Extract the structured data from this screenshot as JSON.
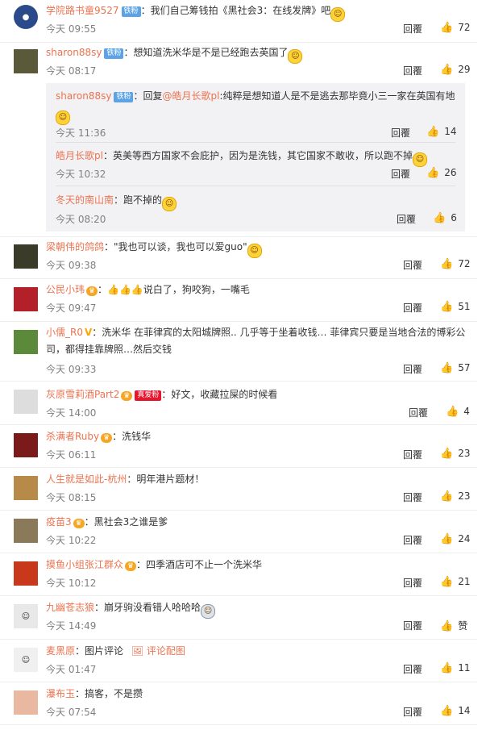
{
  "labels": {
    "reply": "回覆"
  },
  "comments": [
    {
      "user": "学院路书童9527",
      "badge": "铁粉",
      "text": "：我们自己筹钱拍《黑社会3：在线发牌》吧",
      "time": "今天 09:55",
      "likes": "72"
    },
    {
      "user": "sharon88sy",
      "badge": "铁粉",
      "text": "：想知道洗米华是不是已经跑去英国了",
      "time": "今天 08:17",
      "likes": "29",
      "replies": [
        {
          "user": "sharon88sy",
          "badge": "铁粉",
          "prefix": "：回复",
          "mention": "@皓月长歌pl",
          "text": ":纯粹是想知道人是不是逃去那毕竟小三一家在英国有地",
          "time": "今天 11:36",
          "likes": "14"
        },
        {
          "user": "皓月长歌pl",
          "text": "：英美等西方国家不会庇护，因为是洗钱，其它国家不敢收，所以跑不掉",
          "time": "今天 10:32",
          "likes": "26"
        },
        {
          "user": "冬天的南山南",
          "text": "：跑不掉的",
          "time": "今天 08:20",
          "likes": "6"
        }
      ]
    },
    {
      "user": "梁朝伟的鸽鸽",
      "text": "：\"我也可以谈，我也可以爱guo\"",
      "time": "今天 09:38",
      "likes": "72"
    },
    {
      "user": "公民小玮",
      "text": "说白了，狗咬狗，一嘴毛",
      "time": "今天 09:47",
      "likes": "51"
    },
    {
      "user": "小儒_R0",
      "text": "：洗米华 在菲律宾的太阳城牌照.. 几乎等于坐着收钱… 菲律宾只要是当地合法的博彩公司，都得挂靠牌照…然后交钱",
      "time": "今天 09:33",
      "likes": "57"
    },
    {
      "user": "灰原雪莉酒Part2",
      "badge": "真爱粉",
      "text": "：好文，收藏拉屎的时候看",
      "time": "今天 14:00",
      "likes": "4"
    },
    {
      "user": "杀满者Ruby",
      "text": "：洗钱华",
      "time": "今天 06:11",
      "likes": "23"
    },
    {
      "user": "人生就是如此-杭州",
      "text": "：明年港片题材！",
      "time": "今天 08:15",
      "likes": "23"
    },
    {
      "user": "疫苗3",
      "text": "：黑社会3之谁是爹",
      "time": "今天 10:22",
      "likes": "24"
    },
    {
      "user": "摸鱼小组张江群众",
      "text": "：四季酒店可不止一个洗米华",
      "time": "今天 10:12",
      "likes": "21"
    },
    {
      "user": "九幽苍志狼",
      "text": "：崩牙驹没看错人哈哈哈",
      "time": "今天 14:49",
      "likes": "赞"
    },
    {
      "user": "麦黑原",
      "text": "：图片评论",
      "extra": "评论配图",
      "time": "今天 01:47",
      "likes": "11"
    },
    {
      "user": "瀑布玉",
      "text": "：搞客，不是攒",
      "time": "今天 07:54",
      "likes": "14"
    }
  ],
  "colors": {
    "username": "#eb7350",
    "badge_blue": "#5ba3e6",
    "badge_red": "#e6162d",
    "vip": "#f5a623"
  }
}
